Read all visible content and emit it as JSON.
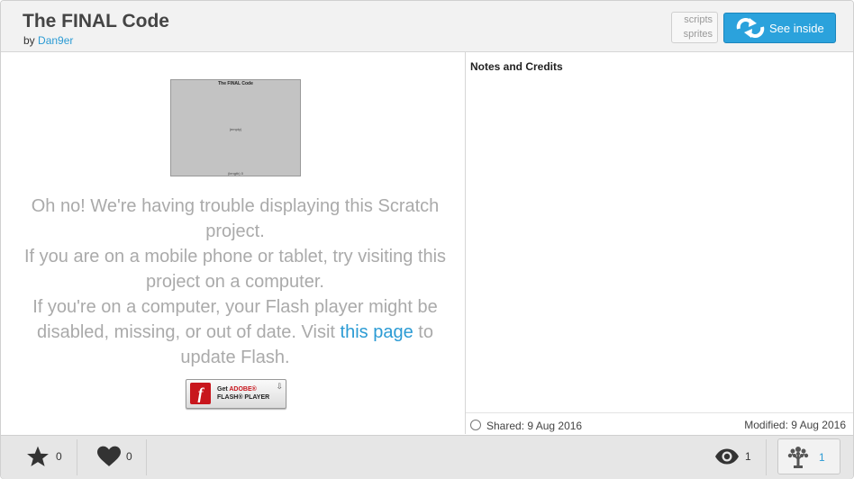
{
  "project": {
    "title": "The FINAL Code",
    "by_prefix": "by",
    "author": "Dan9er"
  },
  "header": {
    "tab_scripts": "scripts",
    "tab_sprites": "sprites",
    "see_inside_label": "See inside"
  },
  "player": {
    "thumbnail": {
      "title": "The FINAL Code",
      "middle_text": "(empty)",
      "bottom_text": "(length) 0"
    },
    "message": {
      "line1": "Oh no! We're having trouble displaying this Scratch project.",
      "line2": "If you are on a mobile phone or tablet, try visiting this project on a computer.",
      "line3_before": "If you're on a computer, your Flash player might be disabled, missing, or out of date. Visit",
      "link_text": "this page",
      "line3_after": "to update Flash."
    },
    "flash_badge": {
      "get": "Get",
      "adobe": "ADOBE®",
      "product": "FLASH® PLAYER"
    }
  },
  "notes": {
    "title": "Notes and Credits"
  },
  "dates": {
    "shared": "Shared: 9 Aug 2016",
    "modified": "Modified: 9 Aug 2016"
  },
  "stats": {
    "favorites": "0",
    "loves": "0",
    "views": "1",
    "remixes": "1"
  },
  "colors": {
    "accent": "#2ba2dc",
    "link": "#2b9bd4"
  }
}
